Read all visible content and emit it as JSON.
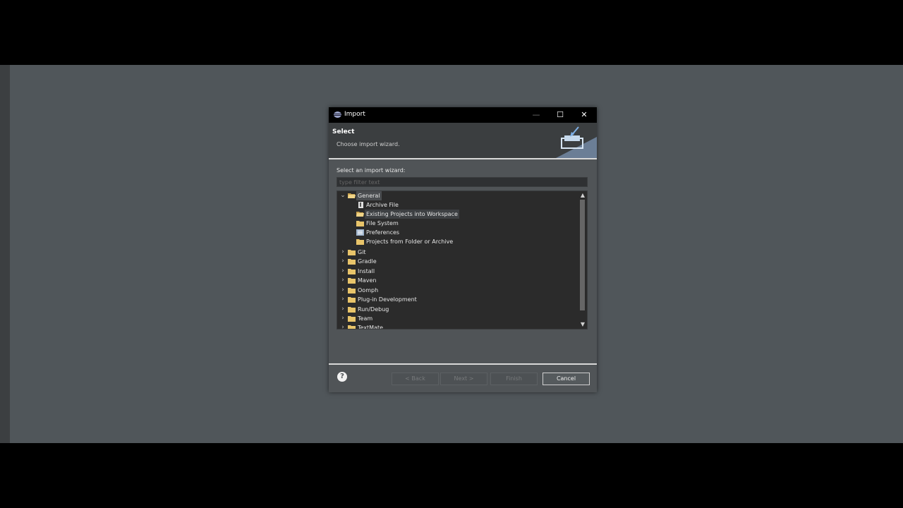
{
  "dialog": {
    "title": "Import",
    "banner_title": "Select",
    "banner_description": "Choose import wizard.",
    "filter_label": "Select an import wizard:",
    "filter_placeholder": "type filter text"
  },
  "window_controls": {
    "minimize": "—",
    "maximize": "☐",
    "close": "✕"
  },
  "tree": {
    "items": [
      {
        "label": "General",
        "level": 0,
        "expanded": true,
        "selected": true,
        "icon": "folder-open-icon"
      },
      {
        "label": "Archive File",
        "level": 1,
        "icon": "archive-file-icon"
      },
      {
        "label": "Existing Projects into Workspace",
        "level": 1,
        "hover": true,
        "icon": "projects-folder-icon"
      },
      {
        "label": "File System",
        "level": 1,
        "icon": "folder-icon"
      },
      {
        "label": "Preferences",
        "level": 1,
        "icon": "preferences-icon"
      },
      {
        "label": "Projects from Folder or Archive",
        "level": 1,
        "icon": "folder-icon"
      },
      {
        "label": "Git",
        "level": 0,
        "expanded": false,
        "icon": "folder-icon"
      },
      {
        "label": "Gradle",
        "level": 0,
        "expanded": false,
        "icon": "folder-icon"
      },
      {
        "label": "Install",
        "level": 0,
        "expanded": false,
        "icon": "folder-icon"
      },
      {
        "label": "Maven",
        "level": 0,
        "expanded": false,
        "icon": "folder-icon"
      },
      {
        "label": "Oomph",
        "level": 0,
        "expanded": false,
        "icon": "folder-icon"
      },
      {
        "label": "Plug-in Development",
        "level": 0,
        "expanded": false,
        "icon": "folder-icon"
      },
      {
        "label": "Run/Debug",
        "level": 0,
        "expanded": false,
        "icon": "folder-icon"
      },
      {
        "label": "Team",
        "level": 0,
        "expanded": false,
        "icon": "folder-icon"
      },
      {
        "label": "TextMate",
        "level": 0,
        "expanded": false,
        "icon": "folder-icon"
      }
    ]
  },
  "buttons": {
    "help": "?",
    "back": "< Back",
    "next": "Next >",
    "finish": "Finish",
    "cancel": "Cancel"
  },
  "colors": {
    "workbench_bg": "#50565a",
    "dialog_bg": "#505457",
    "tree_bg": "#2b2b2b",
    "folder_yellow": "#e8c46a"
  }
}
